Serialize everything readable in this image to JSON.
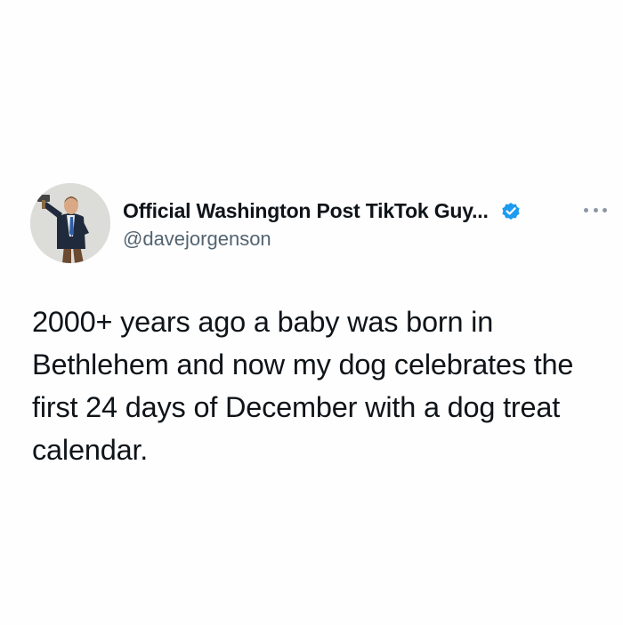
{
  "author": {
    "display_name": "Official Washington Post TikTok Guy...",
    "handle": "@davejorgenson",
    "verified_icon": "verified-badge-icon",
    "verified_color": "#1d9bf0"
  },
  "more_icon": "more-options-icon",
  "tweet": {
    "text": "2000+ years ago a baby was born in Bethlehem and now my dog celebrates the first 24 days of December with a dog treat calendar."
  },
  "colors": {
    "background": "#fefefe",
    "text_primary": "#0f1419",
    "text_secondary": "#536471"
  }
}
